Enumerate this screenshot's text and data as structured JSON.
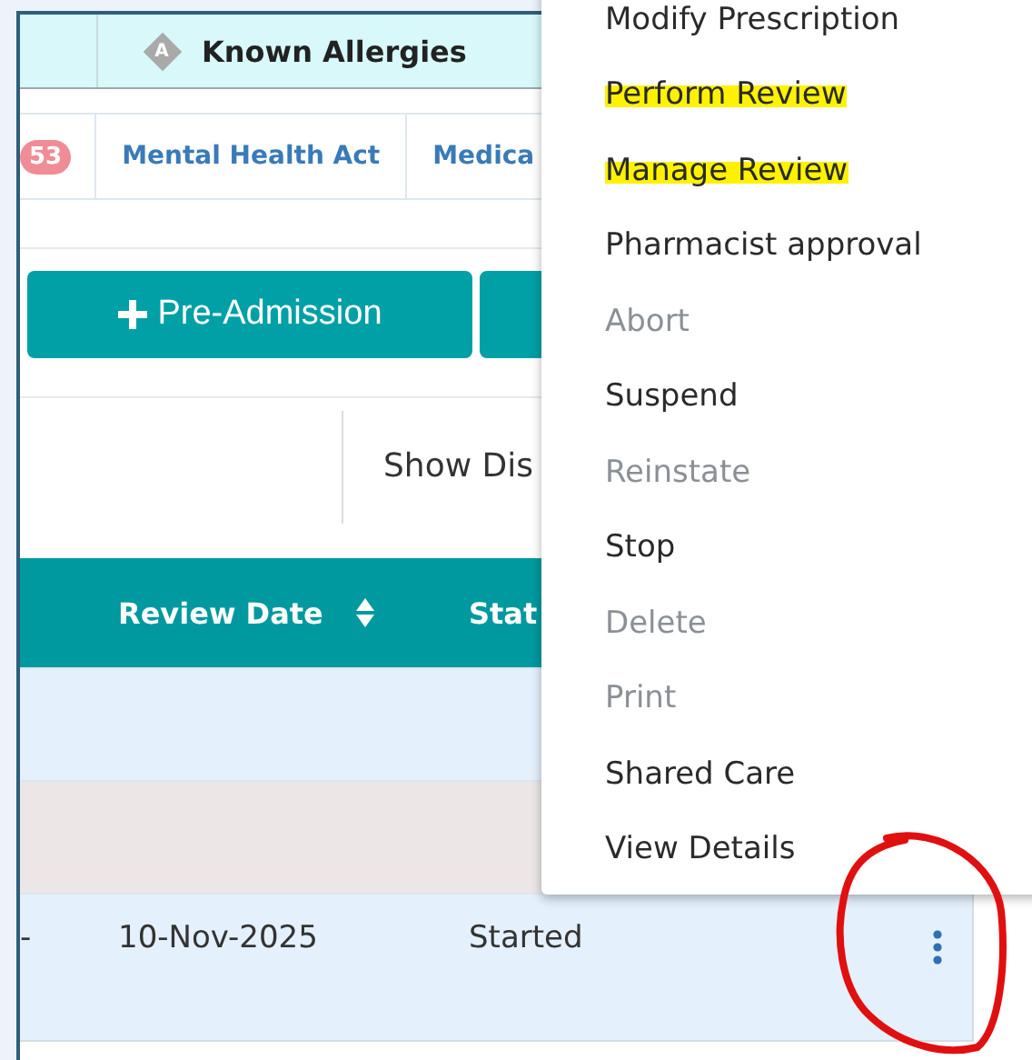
{
  "allergy_banner": {
    "label": "Known Allergies",
    "icon_letter": "A"
  },
  "tabs": [
    {
      "label": "53",
      "kind": "badge"
    },
    {
      "label": "Mental Health Act",
      "kind": "tab"
    },
    {
      "label": "Medica",
      "kind": "tab"
    }
  ],
  "buttons": [
    {
      "label": "Pre-Admission",
      "kind": "add"
    },
    {
      "kind": "blank"
    }
  ],
  "filter": {
    "label": "Show Dis"
  },
  "table": {
    "columns": [
      "",
      "Review Date",
      "Stat",
      ""
    ],
    "rows": [
      {
        "kind": "empty"
      },
      {
        "kind": "empty"
      },
      {
        "kind": "entry",
        "cells": [
          "-",
          "10-Nov-2025",
          "Started"
        ]
      }
    ]
  },
  "menu": {
    "items": [
      {
        "label": "Modify Prescription",
        "disabled": false,
        "highlighted": false
      },
      {
        "label": "Perform Review",
        "disabled": false,
        "highlighted": true
      },
      {
        "label": "Manage Review",
        "disabled": false,
        "highlighted": true
      },
      {
        "label": "Pharmacist approval",
        "disabled": false,
        "highlighted": false
      },
      {
        "label": "Abort",
        "disabled": true,
        "highlighted": false
      },
      {
        "label": "Suspend",
        "disabled": false,
        "highlighted": false
      },
      {
        "label": "Reinstate",
        "disabled": true,
        "highlighted": false
      },
      {
        "label": "Stop",
        "disabled": false,
        "highlighted": false
      },
      {
        "label": "Delete",
        "disabled": true,
        "highlighted": false
      },
      {
        "label": "Print",
        "disabled": true,
        "highlighted": false
      },
      {
        "label": "Shared Care",
        "disabled": false,
        "highlighted": false
      },
      {
        "label": "View Details",
        "disabled": false,
        "highlighted": false
      }
    ]
  },
  "annotations": [
    {
      "kind": "circle"
    }
  ]
}
